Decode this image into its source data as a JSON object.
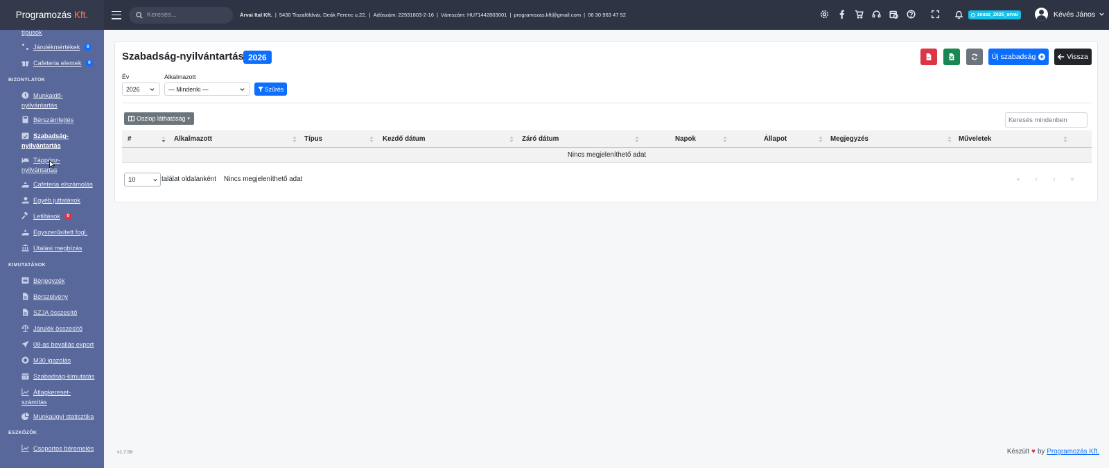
{
  "brand": {
    "name": "Programozás",
    "accent": "Kft."
  },
  "sidebar": {
    "items": [
      {
        "label": "típusok",
        "icon": "none",
        "indent": true
      },
      {
        "label": "Járulékmértékek",
        "icon": "percent-icon",
        "badge": "0",
        "badge_color": "#0d6efd"
      },
      {
        "label": "Cafeteria elemek",
        "icon": "gift-icon",
        "badge": "0",
        "badge_color": "#0d6efd"
      },
      {
        "heading": "BIZONYLATOK"
      },
      {
        "label": "Munkaidő-",
        "label2": "nyilvántartás",
        "icon": "clock-icon"
      },
      {
        "label": "Bérszámfejtés",
        "icon": "calculator-icon"
      },
      {
        "label": "Szabadság-",
        "label2": "nyilvántartás",
        "icon": "calendar-check-icon",
        "active": true
      },
      {
        "label": "Táppénz-",
        "label2": "nyilvántartás",
        "icon": "bed-icon"
      },
      {
        "label": "Cafeteria elszámolás",
        "icon": "hand-holding-icon"
      },
      {
        "label": "Egyéb juttatások",
        "icon": "hand-coin-icon"
      },
      {
        "label": "Letiltások",
        "icon": "gavel-icon",
        "badge": "0",
        "badge_color": "#dc3545"
      },
      {
        "label": "Egyszerűsített fogl.",
        "icon": "hand-holding-icon"
      },
      {
        "label": "Utalási megbízás",
        "icon": "bank-icon"
      },
      {
        "heading": "KIMUTATÁSOK"
      },
      {
        "label": "Bérjegyzék",
        "icon": "list-icon"
      },
      {
        "label": "Bérszelvény",
        "icon": "file-icon"
      },
      {
        "label": "SZJA összesítő",
        "icon": "file-icon"
      },
      {
        "label": "Járulék összesítő",
        "icon": "scale-icon"
      },
      {
        "label": "08-as bevallás export",
        "icon": "paper-plane-icon"
      },
      {
        "label": "M30 igazolás",
        "icon": "certificate-icon"
      },
      {
        "label": "Szabadság-kimutatás",
        "icon": "calendar-icon"
      },
      {
        "label": "Átlagkereset-",
        "label2": "számítás",
        "icon": "chart-line-icon"
      },
      {
        "label": "Munkaügyi statisztika",
        "icon": "chart-pie-icon"
      },
      {
        "heading": "ESZKÖZÖK"
      },
      {
        "label": "Csoportos béremelés",
        "icon": "chart-line-icon"
      }
    ]
  },
  "topbar": {
    "search_placeholder": "Keresés...",
    "company_name": "Árvai Ital Kft.",
    "company_address": "5430 Tiszaföldvár, Deák Ferenc u.22.",
    "tax_number": "Adószám: 22931803-2-16",
    "customs_number": "Vámszám: HU71442803001",
    "email": "programozas.kft@gmail.com",
    "phone": "06 30 963 47 52",
    "db_badge": "zeusz_2026_arvai",
    "user_name": "Kévés János"
  },
  "page": {
    "title": "Szabadság-nyilvántartás",
    "year_badge": "2026",
    "new_button": "Új szabadság",
    "back_button": "Vissza",
    "filter_year_label": "Év",
    "filter_year_value": "2026",
    "filter_employee_label": "Alkalmazott",
    "filter_employee_value": "— Mindenki —",
    "filter_button": "Szűrés",
    "column_visibility": "Oszlop láthatóság",
    "search_placeholder": "Keresés mindenben"
  },
  "table": {
    "columns": [
      "#",
      "Alkalmazott",
      "Típus",
      "Kezdő dátum",
      "Záró dátum",
      "Napok",
      "Állapot",
      "Megjegyzés",
      "Műveletek"
    ],
    "empty_message": "Nincs megjeleníthető adat"
  },
  "pagination": {
    "page_size": "10",
    "per_page_label": "találat oldalanként",
    "info": "Nincs megjeleníthető adat",
    "first": "«",
    "prev": "‹",
    "next": "›",
    "last": "»"
  },
  "footer": {
    "version": "v1.7.58",
    "made_prefix": "Készült",
    "made_by": "by",
    "company_link": "Programozás Kft."
  },
  "colors": {
    "sidebar": "#58689a",
    "topbar": "#2f3445",
    "primary": "#0d6efd",
    "danger": "#dc3545",
    "success": "#198754",
    "secondary": "#6c757d",
    "db_badge": "#17c1e8"
  }
}
